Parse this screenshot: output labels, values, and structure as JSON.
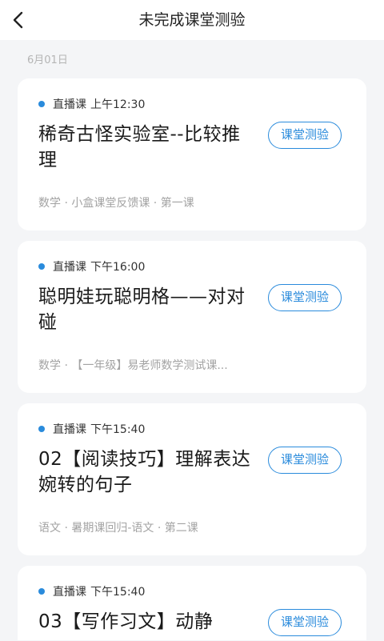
{
  "header": {
    "title": "未完成课堂测验",
    "back_icon": "chevron-left-icon"
  },
  "date_label": "6月01日",
  "colors": {
    "accent": "#2a8bdc",
    "background": "#f4f5f7",
    "card": "#ffffff",
    "subtext": "#a3a3a3"
  },
  "cards": [
    {
      "type": "直播课",
      "time": "上午12:30",
      "title": "稀奇古怪实验室--比较推理",
      "button": "课堂测验",
      "subtitle": "数学 · 小盒课堂反馈课 · 第一课"
    },
    {
      "type": "直播课",
      "time": "下午16:00",
      "title": "聪明娃玩聪明格——对对碰",
      "button": "课堂测验",
      "subtitle": "数学 · 【一年级】易老师数学测试课..."
    },
    {
      "type": "直播课",
      "time": "下午15:40",
      "title": "02【阅读技巧】理解表达婉转的句子",
      "button": "课堂测验",
      "subtitle": "语文 · 暑期课回归-语文 · 第二课"
    },
    {
      "type": "直播课",
      "time": "下午15:40",
      "title": "03【写作习文】动静",
      "button": "课堂测验",
      "subtitle": ""
    }
  ]
}
